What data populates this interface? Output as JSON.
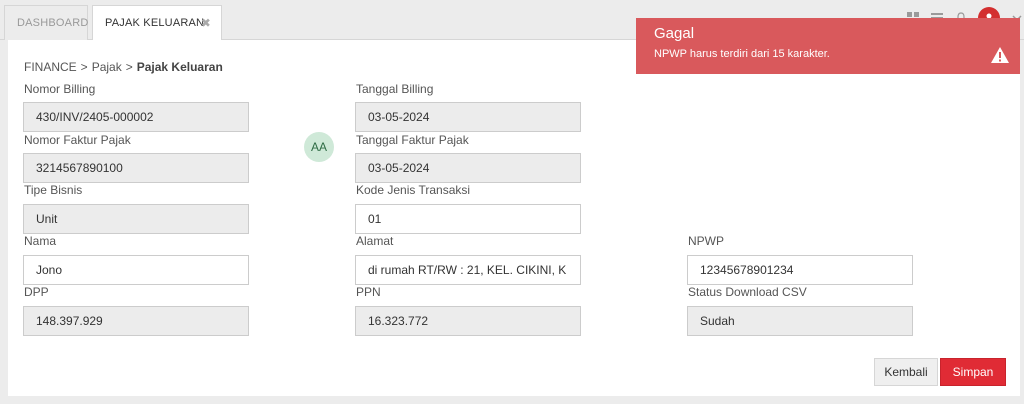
{
  "tabs": {
    "dashboard": "DASHBOARD",
    "active": "PAJAK KELUARAN",
    "close_glyph": "✖"
  },
  "breadcrumb": {
    "items": [
      "FINANCE",
      "Pajak",
      "Pajak Keluaran"
    ],
    "separator": ">"
  },
  "avatar": {
    "initials": "AA"
  },
  "form": {
    "nomor_billing": {
      "label": "Nomor Billing",
      "value": "430/INV/2405-000002"
    },
    "tanggal_billing": {
      "label": "Tanggal Billing",
      "value": "03-05-2024"
    },
    "nomor_faktur": {
      "label": "Nomor Faktur Pajak",
      "value": "3214567890100"
    },
    "tanggal_faktur": {
      "label": "Tanggal Faktur Pajak",
      "value": "03-05-2024"
    },
    "tipe_bisnis": {
      "label": "Tipe Bisnis",
      "value": "Unit"
    },
    "kode_jenis": {
      "label": "Kode Jenis Transaksi",
      "value": "01"
    },
    "nama": {
      "label": "Nama",
      "value": "Jono"
    },
    "alamat": {
      "label": "Alamat",
      "value": "di rumah RT/RW : 21, KEL. CIKINI, K"
    },
    "npwp": {
      "label": "NPWP",
      "value": "12345678901234"
    },
    "dpp": {
      "label": "DPP",
      "value": "148.397.929"
    },
    "ppn": {
      "label": "PPN",
      "value": "16.323.772"
    },
    "status_csv": {
      "label": "Status Download CSV",
      "value": "Sudah"
    }
  },
  "buttons": {
    "back": "Kembali",
    "save": "Simpan"
  },
  "toast": {
    "title": "Gagal",
    "message": "NPWP harus terdiri dari 15 karakter.",
    "color": "#d9595c"
  },
  "colors": {
    "primary": "#e02b35",
    "avatar_bg": "#cfe9d8"
  }
}
